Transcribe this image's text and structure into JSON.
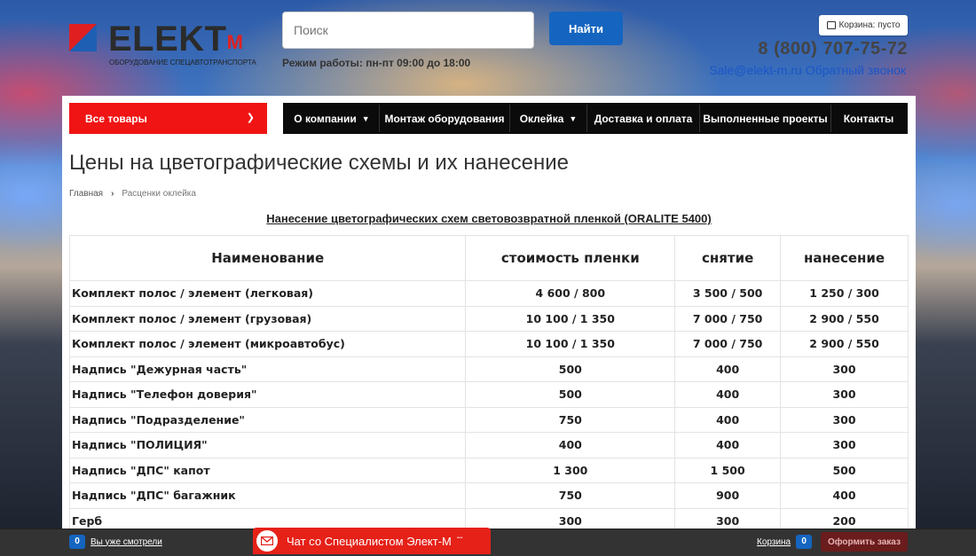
{
  "header": {
    "logo": {
      "word": "ELEKT",
      "accent": "M",
      "tagline": "ОБОРУДОВАНИЕ СПЕЦАВТОТРАНСПОРТА"
    },
    "search": {
      "placeholder": "Поиск",
      "button": "Найти"
    },
    "hours": "Режим работы: пн-пт 09:00 до 18:00",
    "cart": "Корзина: пусто",
    "phone": "8 (800) 707-75-72",
    "email": "Sale@elekt-m.ru",
    "callback": "Обратный звонок"
  },
  "nav": {
    "all_goods": "Все товары",
    "items": [
      "О компании",
      "Монтаж оборудования",
      "Оклейка",
      "Доставка и оплата",
      "Выполненные проекты",
      "Контакты"
    ]
  },
  "page": {
    "title": "Цены на цветографические схемы и их нанесение",
    "breadcrumb": [
      "Главная",
      "Расценки оклейка"
    ]
  },
  "table": {
    "caption": "Нанесение цветографических схем световозвратной пленкой (ORALITE 5400)",
    "headers": [
      "Наименование",
      "стоимость пленки",
      "снятие",
      "нанесение"
    ],
    "rows": [
      [
        "Комплект полос / элемент (легковая)",
        "4 600 / 800",
        "3 500 / 500",
        "1 250 / 300"
      ],
      [
        "Комплект полос / элемент (грузовая)",
        "10 100 / 1 350",
        "7 000 / 750",
        "2 900 / 550"
      ],
      [
        "Комплект полос / элемент (микроавтобус)",
        "10 100 / 1 350",
        "7 000 / 750",
        "2 900 / 550"
      ],
      [
        "Надпись \"Дежурная часть\"",
        "500",
        "400",
        "300"
      ],
      [
        "Надпись \"Телефон доверия\"",
        "500",
        "400",
        "300"
      ],
      [
        "Надпись \"Подразделение\"",
        "750",
        "400",
        "300"
      ],
      [
        "Надпись \"ПОЛИЦИЯ\"",
        "400",
        "400",
        "300"
      ],
      [
        "Надпись \"ДПС\" капот",
        "1 300",
        "1 500",
        "500"
      ],
      [
        "Надпись \"ДПС\" багажник",
        "750",
        "900",
        "400"
      ],
      [
        "Герб",
        "300",
        "300",
        "200"
      ]
    ]
  },
  "bottombar": {
    "viewed_count": "0",
    "viewed_label": "Вы уже смотрели",
    "chat_label": "Чат со Специалистом Элект-М",
    "cart_label": "Корзина",
    "cart_count": "0",
    "order_button": "Оформить заказ"
  },
  "colors": {
    "accent_red": "#f01414",
    "accent_blue": "#1565c0",
    "nav_bg": "#0b0b0b"
  }
}
